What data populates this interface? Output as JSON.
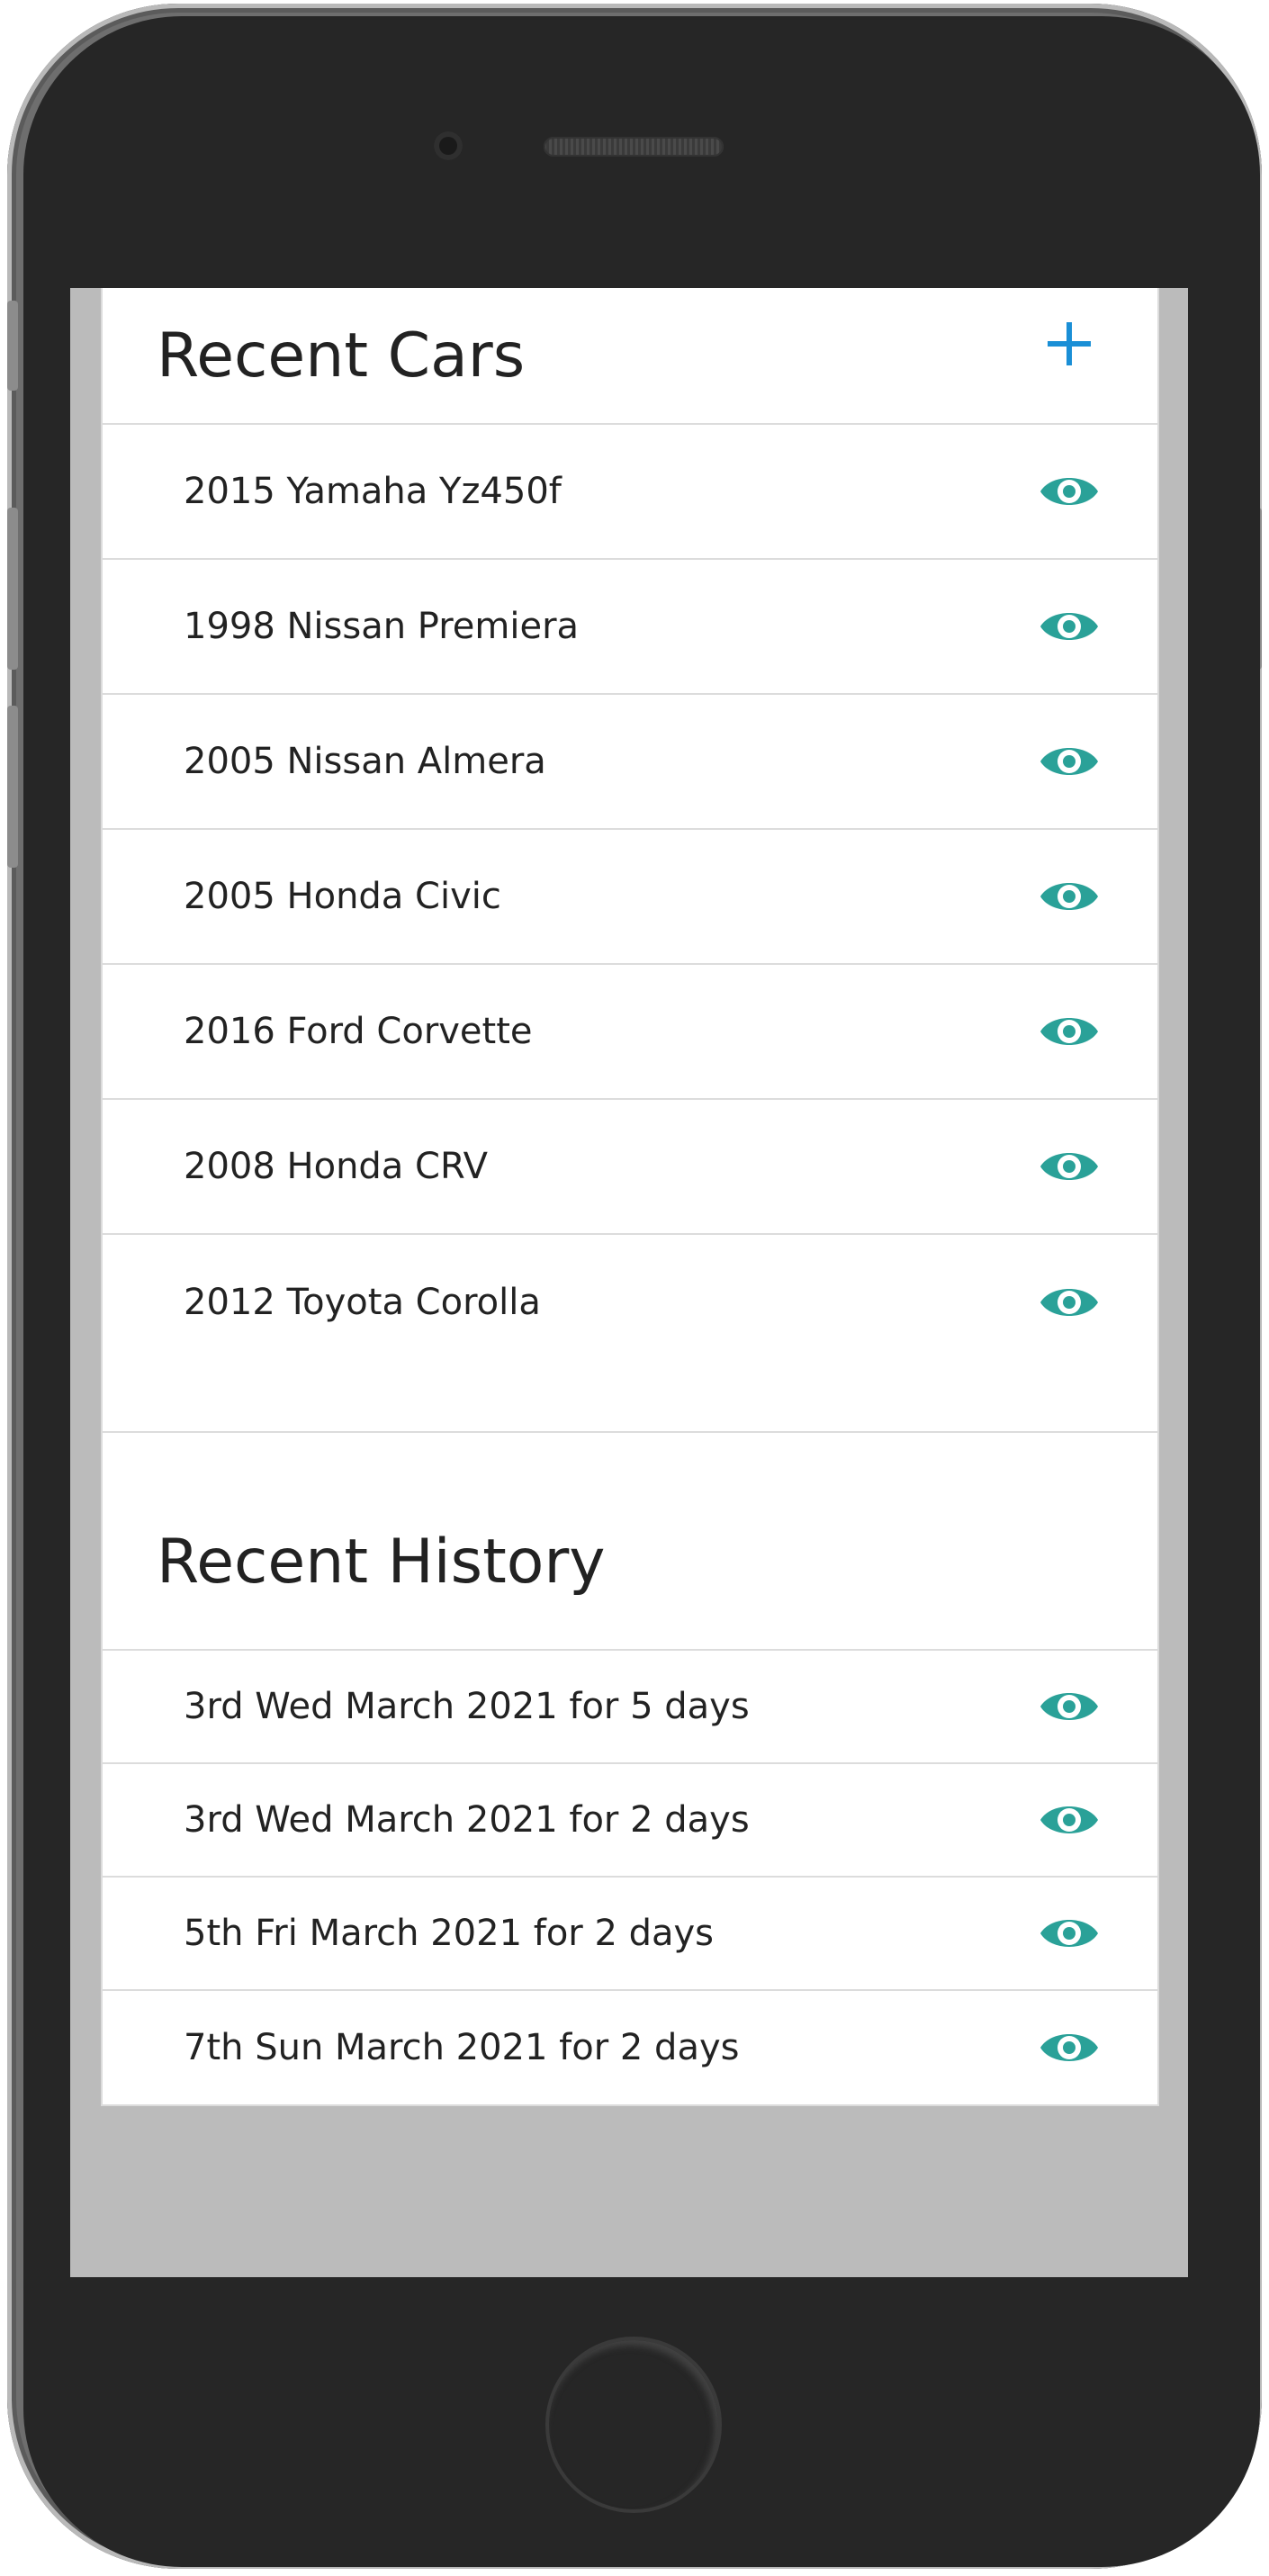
{
  "recent_cars": {
    "title": "Recent Cars",
    "add_icon": "plus-icon",
    "items": [
      {
        "label": "2015 Yamaha Yz450f",
        "icon": "eye-icon"
      },
      {
        "label": "1998 Nissan Premiera",
        "icon": "eye-icon"
      },
      {
        "label": "2005 Nissan Almera",
        "icon": "eye-icon"
      },
      {
        "label": "2005 Honda Civic",
        "icon": "eye-icon"
      },
      {
        "label": "2016 Ford Corvette",
        "icon": "eye-icon"
      },
      {
        "label": "2008 Honda CRV",
        "icon": "eye-icon"
      },
      {
        "label": "2012 Toyota Corolla",
        "icon": "eye-icon"
      }
    ]
  },
  "recent_history": {
    "title": "Recent History",
    "items": [
      {
        "label": "3rd Wed March 2021 for 5 days",
        "icon": "eye-icon"
      },
      {
        "label": "3rd Wed March 2021 for 2 days",
        "icon": "eye-icon"
      },
      {
        "label": "5th Fri March 2021 for 2 days",
        "icon": "eye-icon"
      },
      {
        "label": "7th Sun March 2021 for 2 days",
        "icon": "eye-icon"
      }
    ]
  },
  "colors": {
    "accent_add": "#1a8fd6",
    "accent_view": "#2aa198",
    "screen_background": "#bbbbbb",
    "card_background": "#ffffff",
    "text": "#222222"
  }
}
